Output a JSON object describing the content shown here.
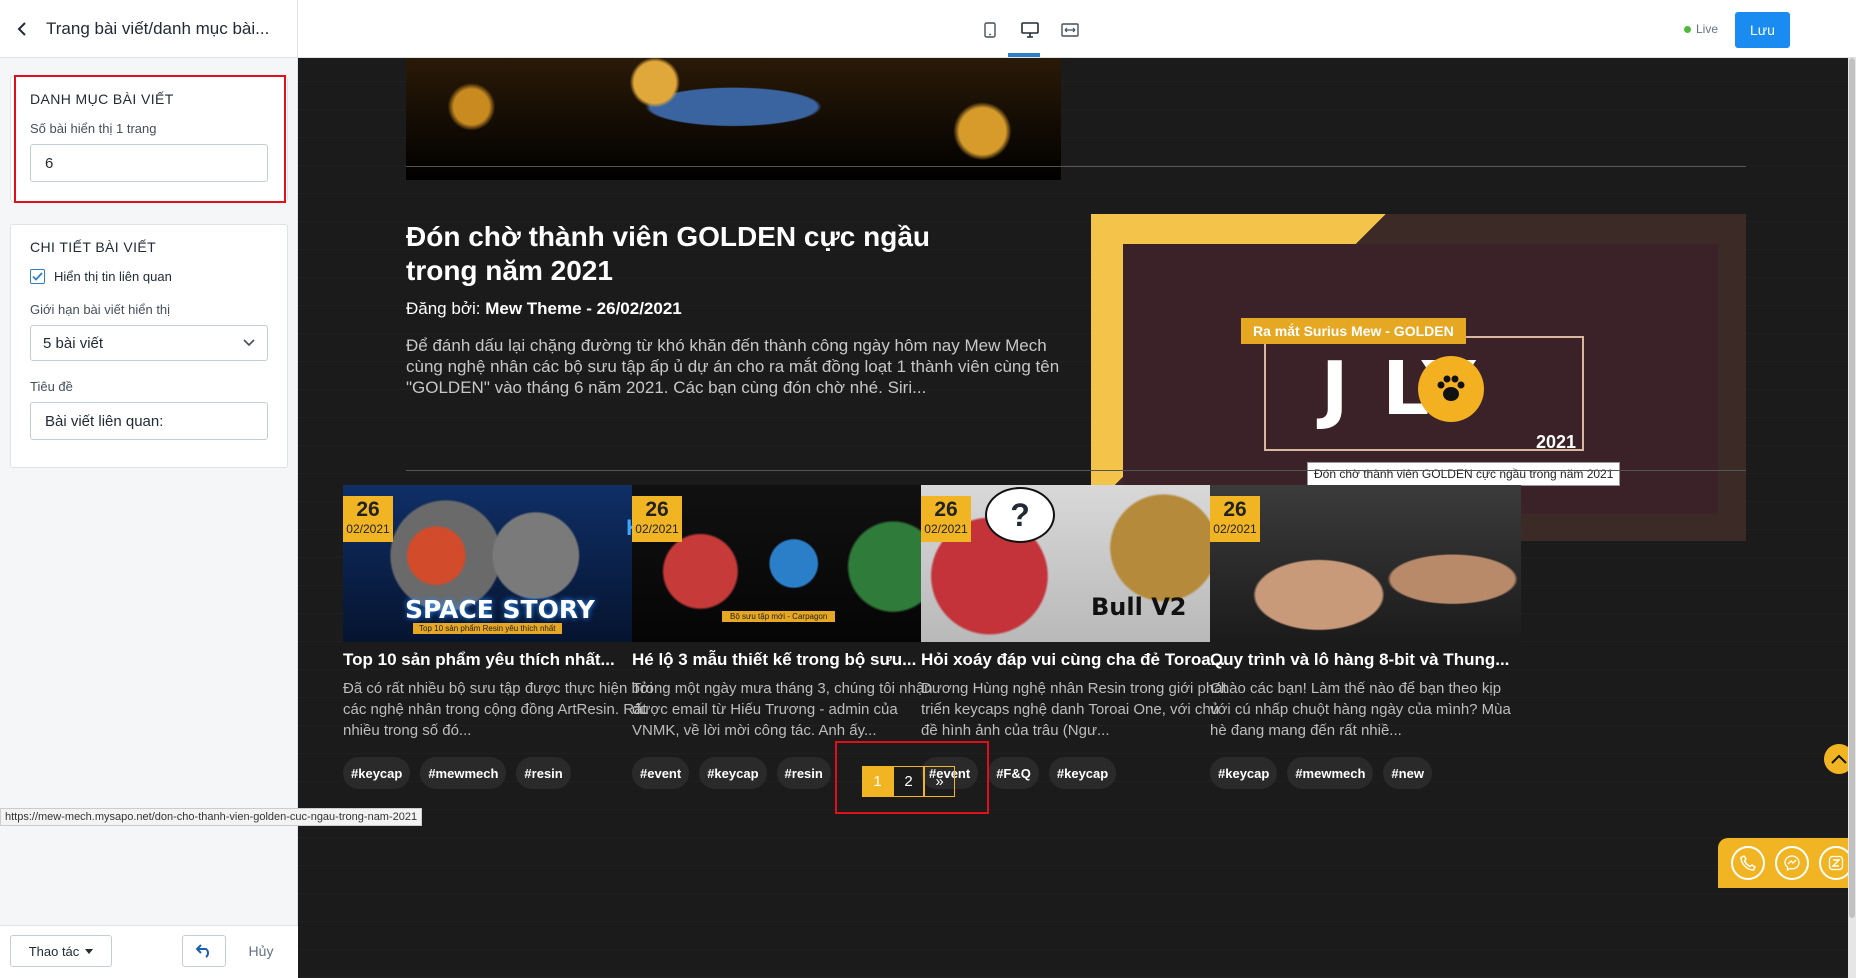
{
  "sidebar": {
    "header_title": "Trang bài viết/danh mục bài...",
    "panel_category": {
      "title": "DANH MỤC BÀI VIẾT",
      "per_page_label": "Số bài hiển thị 1 trang",
      "per_page_value": "6"
    },
    "panel_detail": {
      "title": "CHI TIẾT BÀI VIẾT",
      "related_checkbox_label": "Hiển thị tin liên quan",
      "related_checked": true,
      "limit_label": "Giới hạn bài viết hiển thị",
      "limit_value": "5 bài viết",
      "heading_label": "Tiêu đề",
      "heading_value": "Bài viết liên quan:"
    },
    "footer": {
      "actions_label": "Thao tác",
      "cancel_label": "Hủy"
    }
  },
  "topbar": {
    "live_label": "Live",
    "save_label": "Lưu",
    "devices": [
      "mobile-icon",
      "desktop-icon",
      "fullwidth-icon"
    ],
    "active_device": "desktop-icon"
  },
  "preview": {
    "featured": {
      "title": "Đón chờ thành viên GOLDEN cực ngầu trong năm 2021",
      "by_prefix": "Đăng bởi: ",
      "by_value": "Mew Theme - 26/02/2021",
      "description": "Để đánh dấu lại chặng đường từ khó khăn đến thành công ngày hôm nay Mew Mech cùng nghệ nhân các bộ sưu tập ấp ủ dự án cho ra mắt đồng loạt 1 thành viên cùng tên \"GOLDEN\" vào tháng 6 năm 2021. Các bạn cùng đón chờ nhé. Siri...",
      "image_badge": "Ra mắt Surius Mew - GOLDEN",
      "image_word": "J  LY",
      "image_year": "2021",
      "tooltip": "Đón chờ thành viên GOLDEN cực ngầu trong năm 2021"
    },
    "cards": [
      {
        "day": "26",
        "month": "02/2021",
        "thumb_text": "SPACE STORY",
        "thumb_sub": "Top 10 sản phẩm Resin yêu thích nhất",
        "thumb_k": "K",
        "title": "Top 10 sản phẩm yêu thích nhất...",
        "desc": "Đã có rất nhiều bộ sưu tập được thực hiện bởi các nghệ nhân trong cộng đồng ArtResin. Rất nhiều trong số đó...",
        "tags": [
          "#keycap",
          "#mewmech",
          "#resin"
        ]
      },
      {
        "day": "26",
        "month": "02/2021",
        "thumb_sub": "Bộ sưu tập mới - Carpagon",
        "title": "Hé lộ 3 mẫu thiết kế trong bộ sưu...",
        "desc": "Trong một ngày mưa tháng 3, chúng tôi nhận được email từ Hiếu Trương - admin của VNMK, về lời mời công tác. Anh ấy...",
        "tags": [
          "#event",
          "#keycap",
          "#resin"
        ]
      },
      {
        "day": "26",
        "month": "02/2021",
        "thumb_text": "Bull V2",
        "thumb_bubble": "?",
        "title": "Hỏi xoáy đáp vui cùng cha đẻ Toroa...",
        "desc": "Dương Hùng nghệ nhân Resin trong giới phát triển keycaps nghệ danh Toroai One, với chủ đề hình ảnh của trâu (Ngư...",
        "tags": [
          "#event",
          "#F&Q",
          "#keycap"
        ]
      },
      {
        "day": "26",
        "month": "02/2021",
        "title": "Quy trình và lô hàng 8-bit và Thung...",
        "desc": "Chào các bạn! Làm thế nào để bạn theo kịp với cú nhấp chuột hàng ngày của mình? Mùa hè đang mang đến rất nhiề...",
        "tags": [
          "#keycap",
          "#mewmech",
          "#new"
        ]
      }
    ],
    "pagination": {
      "pages": [
        "1",
        "2"
      ],
      "next": "»",
      "current": "1"
    }
  },
  "status_url": "https://mew-mech.mysapo.net/don-cho-thanh-vien-golden-cuc-ngau-trong-nam-2021",
  "colors": {
    "accent": "#f1b524",
    "primary": "#1a8bf0",
    "highlight": "#e0101a",
    "live": "#50b83c"
  }
}
